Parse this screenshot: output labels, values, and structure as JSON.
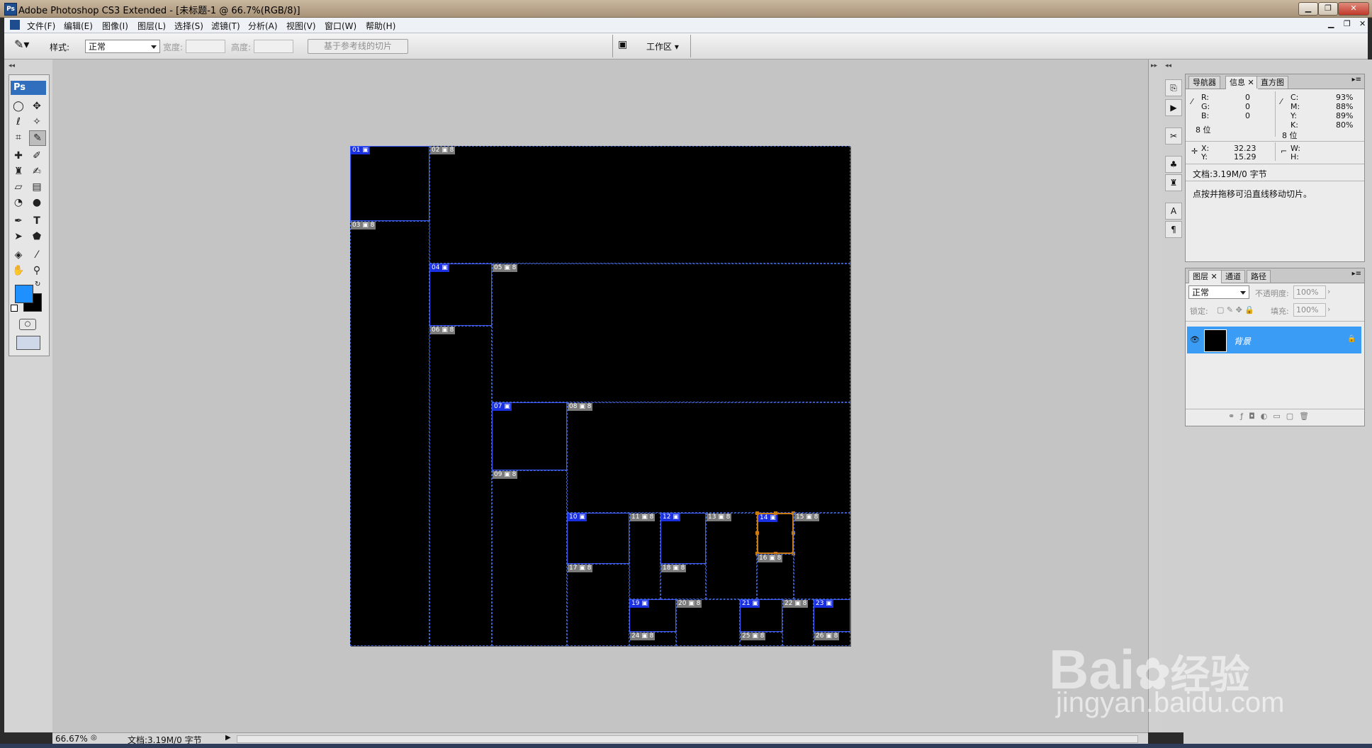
{
  "window": {
    "title": "Adobe Photoshop CS3 Extended - [未标题-1 @ 66.7%(RGB/8)]",
    "ps_icon": "Ps"
  },
  "menu": [
    "文件(F)",
    "编辑(E)",
    "图像(I)",
    "图层(L)",
    "选择(S)",
    "滤镜(T)",
    "分析(A)",
    "视图(V)",
    "窗口(W)",
    "帮助(H)"
  ],
  "options": {
    "style_label": "样式:",
    "style_value": "正常",
    "width_label": "宽度:",
    "height_label": "高度:",
    "slice_button": "基于参考线的切片",
    "workspace_label": "工作区"
  },
  "toolbox": {
    "logo": "Ps",
    "fg_color": "#1e90ff",
    "bg_color": "#000000"
  },
  "slices": [
    {
      "n": "01",
      "user": true
    },
    {
      "n": "02",
      "user": false
    },
    {
      "n": "03",
      "user": false
    },
    {
      "n": "04",
      "user": true
    },
    {
      "n": "05",
      "user": false
    },
    {
      "n": "06",
      "user": false
    },
    {
      "n": "07",
      "user": true
    },
    {
      "n": "08",
      "user": false
    },
    {
      "n": "09",
      "user": false
    },
    {
      "n": "10",
      "user": true
    },
    {
      "n": "11",
      "user": false
    },
    {
      "n": "12",
      "user": true
    },
    {
      "n": "13",
      "user": false
    },
    {
      "n": "14",
      "user": true,
      "selected": true
    },
    {
      "n": "15",
      "user": false
    },
    {
      "n": "16",
      "user": false
    },
    {
      "n": "17",
      "user": false
    },
    {
      "n": "18",
      "user": false
    },
    {
      "n": "19",
      "user": true
    },
    {
      "n": "20",
      "user": false
    },
    {
      "n": "21",
      "user": true
    },
    {
      "n": "22",
      "user": false
    },
    {
      "n": "23",
      "user": true
    },
    {
      "n": "24",
      "user": false
    },
    {
      "n": "25",
      "user": false
    },
    {
      "n": "26",
      "user": false
    }
  ],
  "status": {
    "zoom": "66.67%",
    "doc": "文档:3.19M/0 字节"
  },
  "info_panel": {
    "tabs": [
      "导航器",
      "信息",
      "直方图"
    ],
    "r_label": "R:",
    "r": "0",
    "g_label": "G:",
    "g": "0",
    "b_label": "B:",
    "b": "0",
    "c_label": "C:",
    "c": "93%",
    "m_label": "M:",
    "m": "88%",
    "y_label": "Y:",
    "y": "89%",
    "k_label": "K:",
    "k": "80%",
    "bits_left": "8 位",
    "bits_right": "8 位",
    "x_label": "X:",
    "x": "32.23",
    "ypos_label": "Y:",
    "ypos": "15.29",
    "w_label": "W:",
    "h_label": "H:",
    "doc": "文档:3.19M/0 字节",
    "hint": "点按并拖移可沿直线移动切片。"
  },
  "layers_panel": {
    "tabs": [
      "图层",
      "通道",
      "路径"
    ],
    "blend": "正常",
    "opacity_label": "不透明度:",
    "opacity": "100%",
    "lock_label": "锁定:",
    "fill_label": "填充:",
    "fill": "100%",
    "layer_name": "背景"
  },
  "watermark": {
    "line1": "Bai",
    "line2": "经验",
    "line3": "jingyan.baidu.com"
  }
}
